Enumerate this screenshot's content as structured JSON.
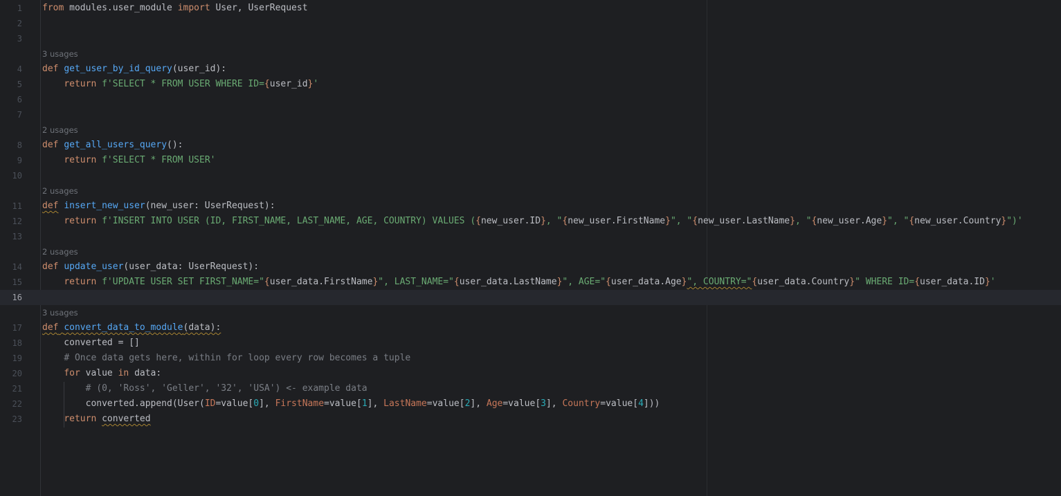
{
  "editor": {
    "language": "python",
    "current_line": 16,
    "colors": {
      "background": "#1e1f22",
      "keyword": "#cf8e6d",
      "function": "#56a8f5",
      "string": "#6aab73",
      "comment": "#7a7e85",
      "number": "#2aacb8",
      "kwarg": "#c77759",
      "text": "#bcbec4"
    },
    "rows": [
      {
        "ln": "1",
        "tokens": [
          {
            "t": "from",
            "c": "kw"
          },
          {
            "t": " modules.user_module ",
            "c": "plain"
          },
          {
            "t": "import",
            "c": "kw"
          },
          {
            "t": " User, UserRequest",
            "c": "plain"
          }
        ]
      },
      {
        "ln": "2",
        "tokens": []
      },
      {
        "ln": "3",
        "tokens": []
      },
      {
        "hint": "3 usages"
      },
      {
        "ln": "4",
        "tokens": [
          {
            "t": "def",
            "c": "kw"
          },
          {
            "t": " ",
            "c": "plain"
          },
          {
            "t": "get_user_by_id_query",
            "c": "fn"
          },
          {
            "t": "(user_id):",
            "c": "plain"
          }
        ]
      },
      {
        "ln": "5",
        "tokens": [
          {
            "t": "    ",
            "c": "plain"
          },
          {
            "t": "return",
            "c": "kw"
          },
          {
            "t": " ",
            "c": "plain"
          },
          {
            "t": "f'SELECT * FROM USER WHERE ID=",
            "c": "str"
          },
          {
            "t": "{",
            "c": "brace"
          },
          {
            "t": "user_id",
            "c": "plain"
          },
          {
            "t": "}",
            "c": "brace"
          },
          {
            "t": "'",
            "c": "str"
          }
        ]
      },
      {
        "ln": "6",
        "tokens": []
      },
      {
        "ln": "7",
        "tokens": []
      },
      {
        "hint": "2 usages"
      },
      {
        "ln": "8",
        "tokens": [
          {
            "t": "def",
            "c": "kw"
          },
          {
            "t": " ",
            "c": "plain"
          },
          {
            "t": "get_all_users_query",
            "c": "fn"
          },
          {
            "t": "():",
            "c": "plain"
          }
        ]
      },
      {
        "ln": "9",
        "tokens": [
          {
            "t": "    ",
            "c": "plain"
          },
          {
            "t": "return",
            "c": "kw"
          },
          {
            "t": " ",
            "c": "plain"
          },
          {
            "t": "f'SELECT * FROM USER'",
            "c": "str"
          }
        ]
      },
      {
        "ln": "10",
        "tokens": []
      },
      {
        "hint": "2 usages"
      },
      {
        "ln": "11",
        "tokens": [
          {
            "t": "def",
            "c": "kw warn"
          },
          {
            "t": " ",
            "c": "plain"
          },
          {
            "t": "insert_new_user",
            "c": "fn"
          },
          {
            "t": "(new_user: UserRequest):",
            "c": "plain"
          }
        ]
      },
      {
        "ln": "12",
        "tokens": [
          {
            "t": "    ",
            "c": "plain"
          },
          {
            "t": "return",
            "c": "kw"
          },
          {
            "t": " ",
            "c": "plain"
          },
          {
            "t": "f'INSERT INTO USER (ID, FIRST_NAME, LAST_NAME, AGE, COUNTRY) VALUES (",
            "c": "str"
          },
          {
            "t": "{",
            "c": "brace"
          },
          {
            "t": "new_user.ID",
            "c": "plain"
          },
          {
            "t": "}",
            "c": "brace"
          },
          {
            "t": ", \"",
            "c": "str"
          },
          {
            "t": "{",
            "c": "brace"
          },
          {
            "t": "new_user.FirstName",
            "c": "plain"
          },
          {
            "t": "}",
            "c": "brace"
          },
          {
            "t": "\", \"",
            "c": "str"
          },
          {
            "t": "{",
            "c": "brace"
          },
          {
            "t": "new_user.LastName",
            "c": "plain"
          },
          {
            "t": "}",
            "c": "brace"
          },
          {
            "t": ", \"",
            "c": "str"
          },
          {
            "t": "{",
            "c": "brace"
          },
          {
            "t": "new_user.Age",
            "c": "plain"
          },
          {
            "t": "}",
            "c": "brace"
          },
          {
            "t": "\", \"",
            "c": "str"
          },
          {
            "t": "{",
            "c": "brace"
          },
          {
            "t": "new_user.Country",
            "c": "plain"
          },
          {
            "t": "}",
            "c": "brace"
          },
          {
            "t": "\")'",
            "c": "str"
          }
        ]
      },
      {
        "ln": "13",
        "tokens": []
      },
      {
        "hint": "2 usages"
      },
      {
        "ln": "14",
        "tokens": [
          {
            "t": "def",
            "c": "kw"
          },
          {
            "t": " ",
            "c": "plain"
          },
          {
            "t": "update_user",
            "c": "fn"
          },
          {
            "t": "(user_data: UserRequest):",
            "c": "plain"
          }
        ]
      },
      {
        "ln": "15",
        "tokens": [
          {
            "t": "    ",
            "c": "plain"
          },
          {
            "t": "return",
            "c": "kw"
          },
          {
            "t": " ",
            "c": "plain"
          },
          {
            "t": "f'UPDATE USER SET FIRST_NAME=\"",
            "c": "str"
          },
          {
            "t": "{",
            "c": "brace"
          },
          {
            "t": "user_data.FirstName",
            "c": "plain"
          },
          {
            "t": "}",
            "c": "brace"
          },
          {
            "t": "\", LAST_NAME=\"",
            "c": "str"
          },
          {
            "t": "{",
            "c": "brace"
          },
          {
            "t": "user_data.LastName",
            "c": "plain"
          },
          {
            "t": "}",
            "c": "brace"
          },
          {
            "t": "\", AGE=\"",
            "c": "str"
          },
          {
            "t": "{",
            "c": "brace"
          },
          {
            "t": "user_data.Age",
            "c": "plain"
          },
          {
            "t": "}",
            "c": "brace"
          },
          {
            "t": "\", COUNTRY=\"",
            "c": "str warn"
          },
          {
            "t": "{",
            "c": "brace"
          },
          {
            "t": "user_data.Country",
            "c": "plain"
          },
          {
            "t": "}",
            "c": "brace"
          },
          {
            "t": "\" WHERE ID=",
            "c": "str"
          },
          {
            "t": "{",
            "c": "brace"
          },
          {
            "t": "user_data.ID",
            "c": "plain"
          },
          {
            "t": "}",
            "c": "brace"
          },
          {
            "t": "'",
            "c": "str"
          }
        ]
      },
      {
        "ln": "16",
        "tokens": [],
        "current": true
      },
      {
        "hint": "3 usages"
      },
      {
        "ln": "17",
        "tokens": [
          {
            "t": "def",
            "c": "kw warn"
          },
          {
            "t": " ",
            "c": "plain warn"
          },
          {
            "t": "convert_data_to_module",
            "c": "fn warn"
          },
          {
            "t": "(data):",
            "c": "plain warn"
          }
        ]
      },
      {
        "ln": "18",
        "tokens": [
          {
            "t": "    converted = []",
            "c": "plain"
          }
        ]
      },
      {
        "ln": "19",
        "tokens": [
          {
            "t": "    ",
            "c": "plain"
          },
          {
            "t": "# Once data gets here, within for loop every row becomes a tuple",
            "c": "cmt"
          }
        ]
      },
      {
        "ln": "20",
        "tokens": [
          {
            "t": "    ",
            "c": "plain"
          },
          {
            "t": "for",
            "c": "kw"
          },
          {
            "t": " value ",
            "c": "plain"
          },
          {
            "t": "in",
            "c": "kw"
          },
          {
            "t": " data:",
            "c": "plain"
          }
        ]
      },
      {
        "ln": "21",
        "tokens": [
          {
            "t": "        ",
            "c": "plain"
          },
          {
            "t": "# (0, 'Ross', 'Geller', '32', 'USA') <- example data",
            "c": "cmt"
          }
        ]
      },
      {
        "ln": "22",
        "tokens": [
          {
            "t": "        converted.append(User(",
            "c": "plain"
          },
          {
            "t": "ID",
            "c": "kwarg"
          },
          {
            "t": "=value[",
            "c": "plain"
          },
          {
            "t": "0",
            "c": "num"
          },
          {
            "t": "], ",
            "c": "plain"
          },
          {
            "t": "FirstName",
            "c": "kwarg"
          },
          {
            "t": "=value[",
            "c": "plain"
          },
          {
            "t": "1",
            "c": "num"
          },
          {
            "t": "], ",
            "c": "plain"
          },
          {
            "t": "LastName",
            "c": "kwarg"
          },
          {
            "t": "=value[",
            "c": "plain"
          },
          {
            "t": "2",
            "c": "num"
          },
          {
            "t": "], ",
            "c": "plain"
          },
          {
            "t": "Age",
            "c": "kwarg"
          },
          {
            "t": "=value[",
            "c": "plain"
          },
          {
            "t": "3",
            "c": "num"
          },
          {
            "t": "], ",
            "c": "plain"
          },
          {
            "t": "Country",
            "c": "kwarg"
          },
          {
            "t": "=value[",
            "c": "plain"
          },
          {
            "t": "4",
            "c": "num"
          },
          {
            "t": "]))",
            "c": "plain"
          }
        ]
      },
      {
        "ln": "23",
        "tokens": [
          {
            "t": "    ",
            "c": "plain"
          },
          {
            "t": "return",
            "c": "kw"
          },
          {
            "t": " ",
            "c": "plain"
          },
          {
            "t": "converted",
            "c": "plain warn"
          }
        ]
      }
    ]
  }
}
